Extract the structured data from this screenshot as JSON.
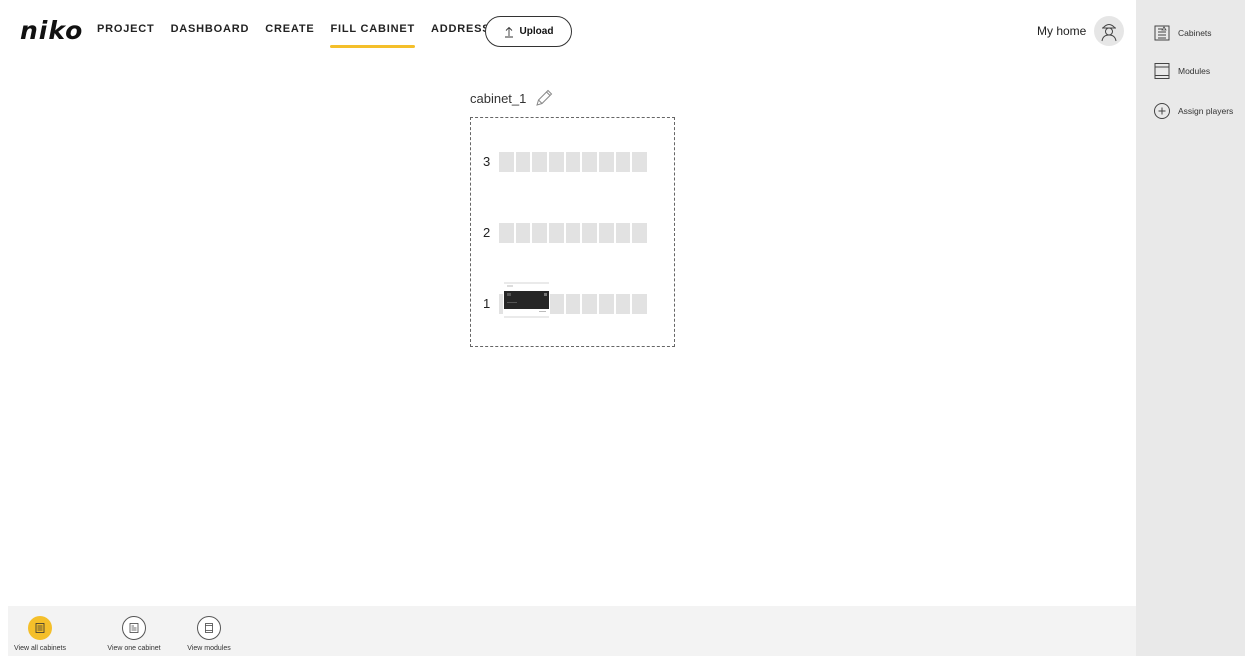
{
  "brand": {
    "logo_text": "niko",
    "accent_color": "#f4bf2a"
  },
  "nav": {
    "items": [
      {
        "label": "PROJECT",
        "active": false
      },
      {
        "label": "DASHBOARD",
        "active": false
      },
      {
        "label": "CREATE",
        "active": false
      },
      {
        "label": "FILL CABINET",
        "active": true
      },
      {
        "label": "ADDRESS",
        "active": false
      }
    ],
    "upload_label": "Upload",
    "upload_icon": "upload-arrow-icon"
  },
  "user": {
    "name": "My home",
    "avatar_icon": "installer-avatar-icon"
  },
  "right_panel": {
    "items": [
      {
        "label": "Cabinets",
        "icon": "cabinet-icon"
      },
      {
        "label": "Modules",
        "icon": "module-icon"
      },
      {
        "label": "Assign players",
        "icon": "plus-circle-icon"
      }
    ]
  },
  "cabinet": {
    "name": "cabinet_1",
    "rows": [
      {
        "number": "3",
        "slots": 9,
        "module": false
      },
      {
        "number": "2",
        "slots": 9,
        "module": false
      },
      {
        "number": "1",
        "slots": 9,
        "module": true
      }
    ]
  },
  "bottom_bar": {
    "items": [
      {
        "label": "View all cabinets",
        "icon": "all-cabinets-icon",
        "active": true
      },
      {
        "label": "View one cabinet",
        "icon": "one-cabinet-icon",
        "active": false
      },
      {
        "label": "View modules",
        "icon": "modules-view-icon",
        "active": false
      }
    ]
  }
}
